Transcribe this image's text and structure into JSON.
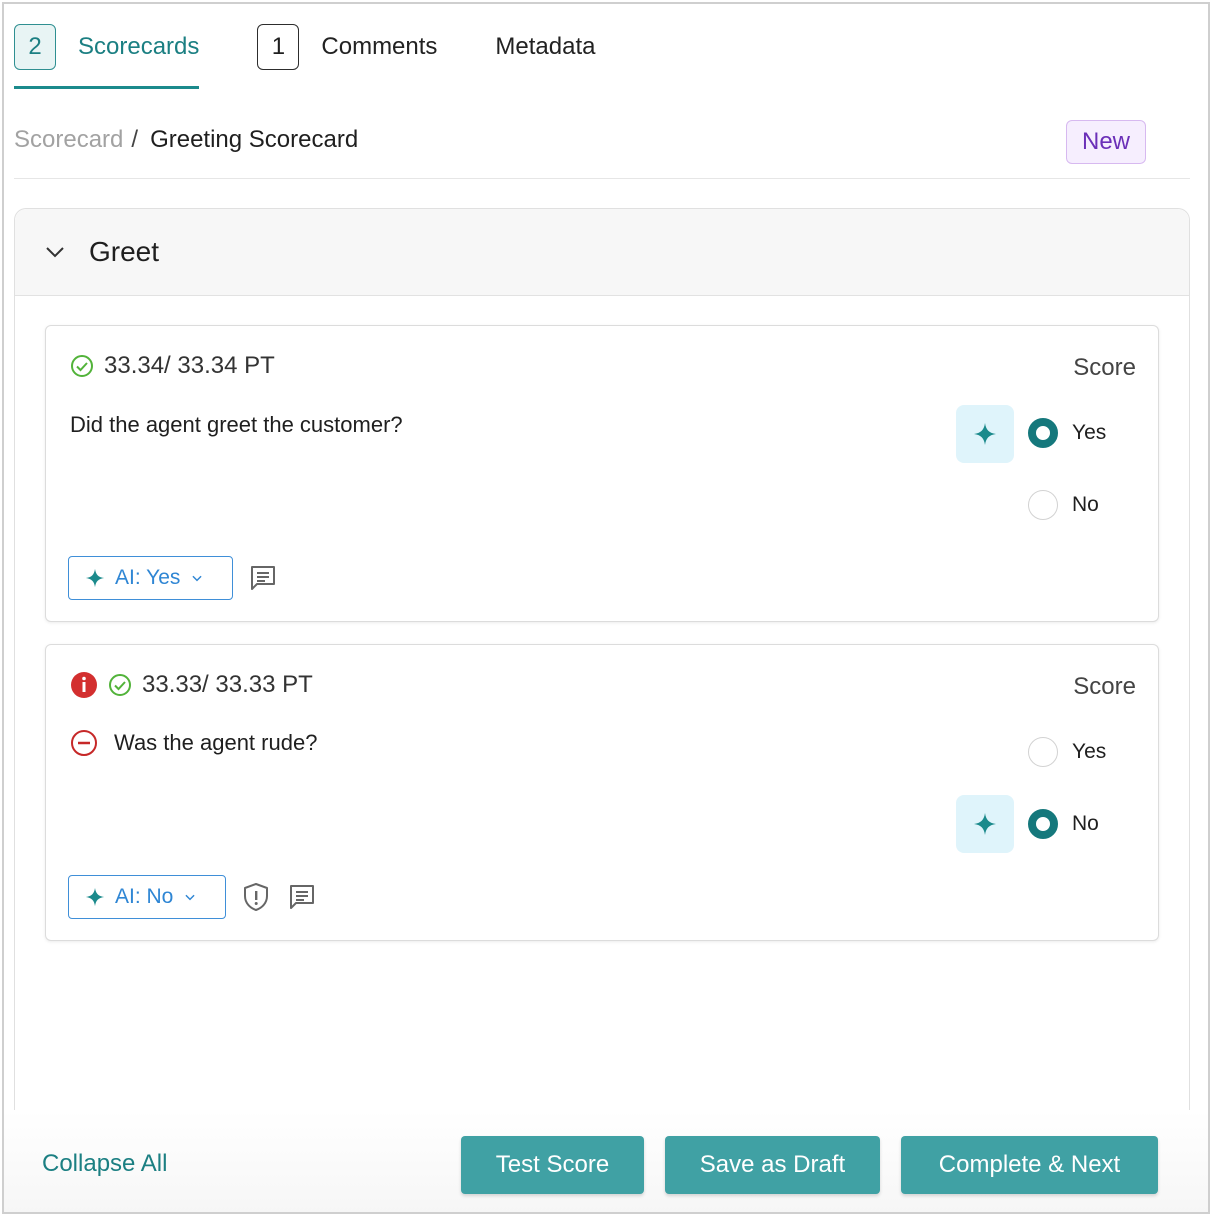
{
  "tabs": [
    {
      "count": "2",
      "label": "Scorecards"
    },
    {
      "count": "1",
      "label": "Comments"
    },
    {
      "label": "Metadata"
    }
  ],
  "breadcrumb": {
    "parent": "Scorecard",
    "separator": "/",
    "current": "Greeting Scorecard"
  },
  "status_badge": "New",
  "section": {
    "title": "Greet"
  },
  "questions": [
    {
      "points": "33.34/ 33.34 PT",
      "score_label": "Score",
      "text": "Did the agent greet the customer?",
      "options": [
        "Yes",
        "No"
      ],
      "selected": "Yes",
      "ai_label": "AI: Yes"
    },
    {
      "points": "33.33/ 33.33 PT",
      "score_label": "Score",
      "text": "Was the agent rude?",
      "options": [
        "Yes",
        "No"
      ],
      "selected": "No",
      "ai_label": "AI: No"
    }
  ],
  "footer": {
    "collapse_all": "Collapse All",
    "test_score": "Test Score",
    "save_draft": "Save as Draft",
    "complete_next": "Complete & Next"
  },
  "colors": {
    "accent": "#1b7f82",
    "button": "#40a1a4",
    "ai_blue": "#2f86d4",
    "error": "#d32f2f",
    "success": "#4caf50",
    "badge_purple": "#6b2fb8"
  }
}
